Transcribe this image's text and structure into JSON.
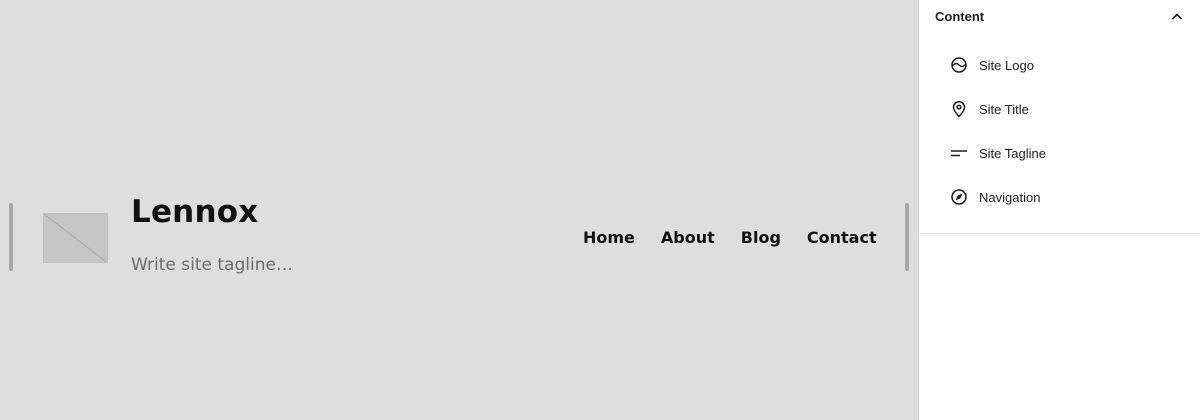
{
  "canvas": {
    "site_title": "Lennox",
    "site_tagline_placeholder": "Write site tagline…",
    "navigation": [
      {
        "label": "Home"
      },
      {
        "label": "About"
      },
      {
        "label": "Blog"
      },
      {
        "label": "Contact"
      }
    ]
  },
  "sidebar": {
    "section_title": "Content",
    "items": [
      {
        "label": "Site Logo",
        "icon": "site-logo-icon"
      },
      {
        "label": "Site Title",
        "icon": "map-marker-icon"
      },
      {
        "label": "Site Tagline",
        "icon": "tagline-icon"
      },
      {
        "label": "Navigation",
        "icon": "compass-icon"
      }
    ]
  },
  "colors": {
    "canvas_background": "#dedede",
    "text_primary": "#111111",
    "tagline_text": "#6b6b6b",
    "sidebar_background": "#ffffff"
  }
}
